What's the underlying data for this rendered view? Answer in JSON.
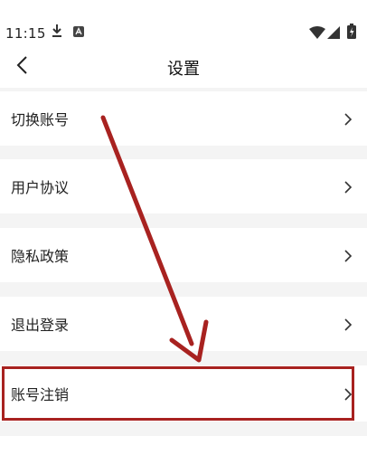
{
  "status_bar": {
    "time": "11:15"
  },
  "header": {
    "title": "设置"
  },
  "settings": {
    "items": [
      {
        "label": "切换账号"
      },
      {
        "label": "用户协议"
      },
      {
        "label": "隐私政策"
      },
      {
        "label": "退出登录"
      },
      {
        "label": "账号注销"
      }
    ]
  },
  "annotation": {
    "arrow_color": "#a82220",
    "highlight_color": "#a82220",
    "highlighted_item": "账号注销"
  }
}
